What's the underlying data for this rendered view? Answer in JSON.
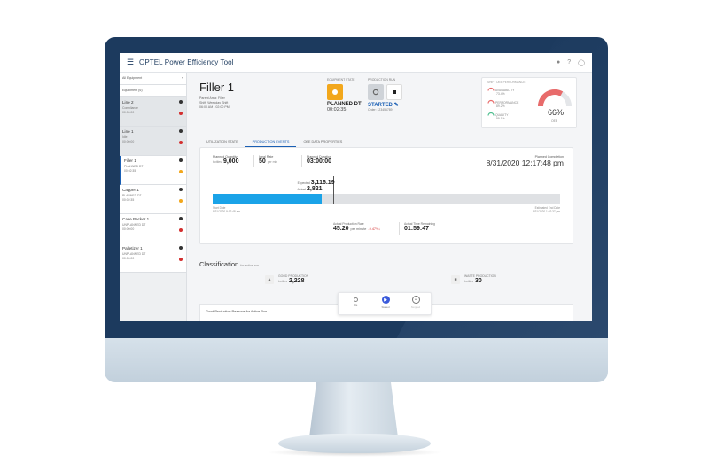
{
  "app": {
    "title": "OPTEL Power Efficiency Tool",
    "icons": [
      "bell-icon",
      "help-icon",
      "account-icon"
    ]
  },
  "colors": {
    "brand": "#1c3a5e",
    "accent": "#1a5fb4",
    "progress": "#1aa3e8",
    "planned_dt": "#f2a71c",
    "stopped": "#d32f2f"
  },
  "sidebar": {
    "selectors": [
      {
        "label": "All Equipment"
      },
      {
        "label": "Equipment (6)"
      }
    ],
    "items": [
      {
        "name": "Line 2",
        "state": "Compliance",
        "time": "00:00:00",
        "dot": "#d32f2f",
        "style": "dark"
      },
      {
        "name": "Line 1",
        "state": "Idle",
        "time": "00:00:00",
        "dot": "#d32f2f",
        "style": "dark"
      },
      {
        "name": "Filler 1",
        "state": "PLANNED DT",
        "time": "00:02:35",
        "dot": "#f2a71c",
        "style": "active"
      },
      {
        "name": "Capper 1",
        "state": "PLANNED DT",
        "time": "00:02:35",
        "dot": "#f2a71c",
        "style": "light"
      },
      {
        "name": "Case Packer 1",
        "state": "UNPLANNED DT",
        "time": "00:00:00",
        "dot": "#d32f2f",
        "style": "light"
      },
      {
        "name": "Palletizer 1",
        "state": "UNPLANNED DT",
        "time": "00:00:00",
        "dot": "#d32f2f",
        "style": "light"
      }
    ]
  },
  "header": {
    "title": "Filler 1",
    "meta_lines": [
      "Parent Area: Filler",
      "Shift: Weekday Shift",
      "06:00 AM - 02:00 PM"
    ],
    "equipment_state": {
      "label": "EQUIPMENT STATE",
      "value": "PLANNED DT",
      "time": "00:02:35"
    },
    "production_run": {
      "label": "PRODUCTION RUN",
      "value": "STARTED",
      "sub": "Order: 123456789"
    }
  },
  "gauge": {
    "title": "SHIFT OEE PERFORMANCE",
    "rows": [
      {
        "label": "AVAILABILITY",
        "value": "73.4%"
      },
      {
        "label": "PERFORMANCE",
        "value": "89.2%"
      },
      {
        "label": "QUALITY",
        "value": "99.1%"
      }
    ],
    "oee_percent": 66,
    "oee_display": "66%",
    "oee_label": "OEE"
  },
  "tabs": [
    {
      "label": "UTILIZATION STATE",
      "active": false
    },
    {
      "label": "PRODUCTION EVENTS",
      "active": true
    },
    {
      "label": "OEE DATA PROPERTIES",
      "active": false
    }
  ],
  "production": {
    "planned_quantity": {
      "label": "Planned Quantity",
      "unit": "bottles",
      "value": "9,000"
    },
    "ideal_rate": {
      "label": "Ideal Rate",
      "value": "50",
      "unit": "per min"
    },
    "planned_duration": {
      "label": "Planned Duration",
      "value": "03:00:00"
    },
    "planned_completion": {
      "label": "Planned Completion",
      "value": "8/31/2020 12:17:48 pm"
    },
    "progress": {
      "fraction": 0.314,
      "actual_label": "Actual",
      "actual_value": "2,821",
      "expected_label": "Expected",
      "expected_value": "3,116.19",
      "expected_fraction": 0.346
    },
    "axis": {
      "left_top": "Start Date",
      "left_bottom": "8/31/2020 9:17:48 am",
      "right_top": "Estimated End Date",
      "right_bottom": "8/31/2020 1:02:37 pm"
    },
    "actual_rate": {
      "label": "Actual Production Rate",
      "value": "45.20",
      "unit": "per minute",
      "trend": "-9.47%"
    },
    "time_remaining": {
      "label": "Actual Time Remaining",
      "value": "01:59:47"
    }
  },
  "classification": {
    "title": "Classification",
    "subtitle": "for active run",
    "good": {
      "label": "GOOD PRODUCTION",
      "unit": "bottles",
      "value": "2,228"
    },
    "waste": {
      "label": "WASTE PRODUCTION",
      "unit": "bottles",
      "value": "30"
    }
  },
  "reasons": {
    "title": "Good Production Reasons for Active Run"
  },
  "stepper": [
    {
      "label": "Idle",
      "active": false
    },
    {
      "label": "Started",
      "active": true
    },
    {
      "label": "Stopped",
      "active": false
    }
  ]
}
